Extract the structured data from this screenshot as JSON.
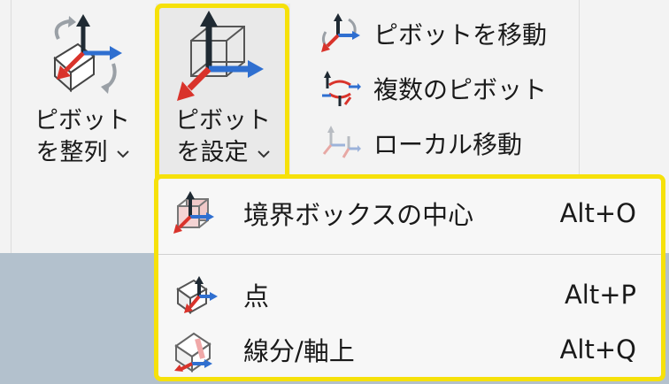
{
  "ribbon": {
    "align_pivot": {
      "line1": "ピボット",
      "line2": "を整列"
    },
    "set_pivot": {
      "line1": "ピボット",
      "line2": "を設定"
    },
    "move_pivot": "ピボットを移動",
    "multiple_pivots": "複数のピボット",
    "local_move": "ローカル移動"
  },
  "menu": {
    "items": [
      {
        "label": "境界ボックスの中心",
        "shortcut": "Alt+O"
      },
      {
        "label": "点",
        "shortcut": "Alt+P"
      },
      {
        "label": "線分/軸上",
        "shortcut": "Alt+Q"
      }
    ]
  },
  "colors": {
    "highlight": "#f6e10a",
    "axis_up": "#1f2a33",
    "axis_right": "#2f6fd0",
    "axis_front": "#d9332b"
  }
}
